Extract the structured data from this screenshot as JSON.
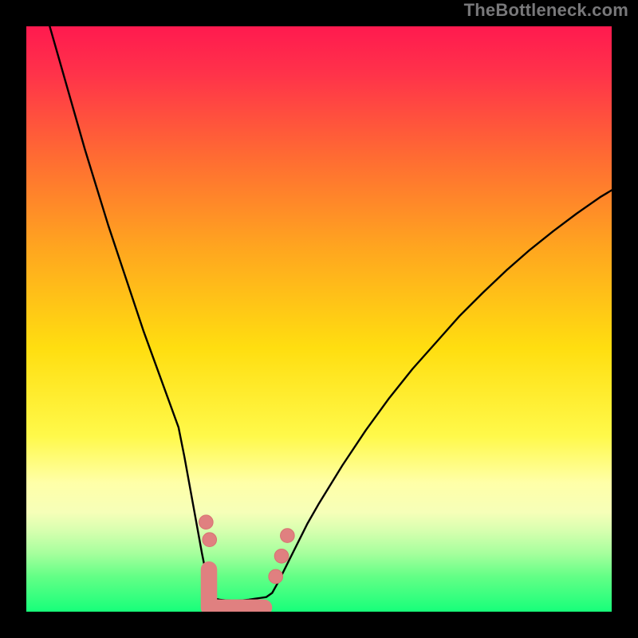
{
  "attribution": "TheBottleneck.com",
  "colors": {
    "gradient_top": "#ff1a4f",
    "gradient_mid1": "#ff7a2a",
    "gradient_mid2": "#ffe100",
    "gradient_band_pale": "#ffffa8",
    "gradient_bottom": "#17ff7a",
    "curve": "#000000",
    "marker_fill": "#e08080",
    "marker_stroke": "#d87272"
  },
  "chart_data": {
    "type": "line",
    "title": "",
    "xlabel": "",
    "ylabel": "",
    "xlim": [
      0,
      100
    ],
    "ylim": [
      0,
      100
    ],
    "grid": false,
    "series": [
      {
        "name": "left-branch",
        "x": [
          4,
          6,
          8,
          10,
          12,
          14,
          16,
          18,
          20,
          22,
          24,
          26,
          27,
          28,
          29,
          30,
          30.8,
          31.5,
          32
        ],
        "y": [
          100,
          93,
          86,
          79,
          72.5,
          66,
          60,
          54,
          48,
          42.5,
          37,
          31.5,
          26.5,
          21,
          15.5,
          10,
          6,
          3.3,
          2.3
        ]
      },
      {
        "name": "floor",
        "x": [
          32,
          33,
          34,
          35,
          36,
          37,
          38,
          39,
          40,
          41
        ],
        "y": [
          2.3,
          2.05,
          1.95,
          1.9,
          1.9,
          1.95,
          2.05,
          2.2,
          2.35,
          2.5
        ]
      },
      {
        "name": "right-branch",
        "x": [
          41,
          42,
          43,
          44,
          46,
          48,
          50,
          54,
          58,
          62,
          66,
          70,
          74,
          78,
          82,
          86,
          90,
          94,
          98,
          100
        ],
        "y": [
          2.5,
          3.2,
          5,
          7,
          11,
          15,
          18.5,
          25,
          31,
          36.5,
          41.5,
          46,
          50.5,
          54.5,
          58.3,
          61.8,
          65,
          68,
          70.8,
          72
        ]
      }
    ],
    "markers": [
      {
        "shape": "circle",
        "x": 30.7,
        "y": 15.3,
        "r": 1.2
      },
      {
        "shape": "circle",
        "x": 31.3,
        "y": 12.3,
        "r": 1.2
      },
      {
        "shape": "round-rect",
        "x1": 31.2,
        "y1": 3.0,
        "x2": 40.6,
        "y2": 0.7,
        "r": 1.4
      },
      {
        "shape": "circle",
        "x": 42.6,
        "y": 6.0,
        "r": 1.2
      },
      {
        "shape": "circle",
        "x": 43.6,
        "y": 9.5,
        "r": 1.2
      },
      {
        "shape": "circle",
        "x": 44.6,
        "y": 13.0,
        "r": 1.2
      }
    ]
  }
}
